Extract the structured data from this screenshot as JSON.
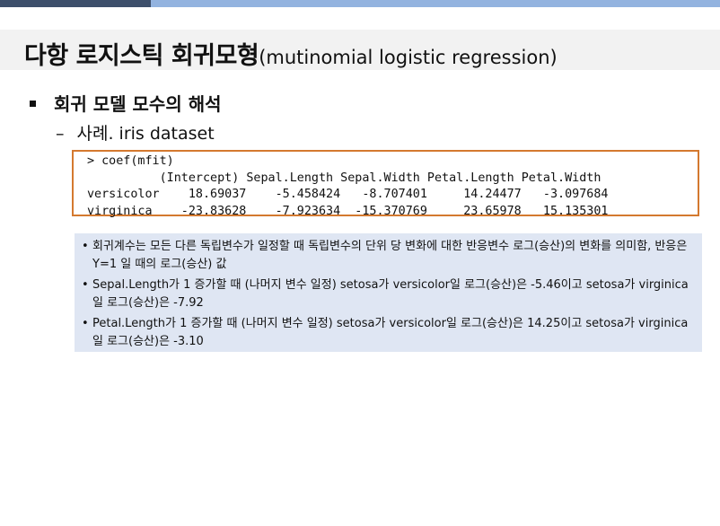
{
  "title": {
    "main": "다항 로지스틱 회귀모형",
    "sub": "(mutinomial logistic regression)"
  },
  "bullet_level1": "회귀 모델 모수의 해석",
  "bullet_level2": {
    "dash": "–",
    "text": "사례. iris dataset"
  },
  "code_output": {
    "command": "> coef(mfit)",
    "header_row": "          (Intercept) Sepal.Length Sepal.Width Petal.Length Petal.Width",
    "row_versicolor": "versicolor    18.69037    -5.458424   -8.707401     14.24477   -3.097684",
    "row_virginica": "virginica    -23.83628    -7.923634  -15.370769     23.65978   15.135301"
  },
  "notes": [
    "회귀계수는 모든 다른 독립변수가 일정할 때 독립변수의 단위 당 변화에 대한 반응변수 로그(승산)의 변화를 의미함,  반응은 Y=1 일 때의 로그(승산) 값",
    "Sepal.Length가  1 증가할 때 (나머지 변수 일정) setosa가 versicolor일 로그(승산)은 -5.46이고 setosa가 virginica일 로그(승산)은 -7.92",
    "Petal.Length가  1 증가할 때 (나머지 변수 일정) setosa가 versicolor일 로그(승산)은  14.25이고 setosa가 virginica일 로그(승산)은 -3.10"
  ],
  "colors": {
    "topbar_dark": "#3d4f6b",
    "topbar_light": "#93b3df",
    "code_border": "#d4792f",
    "note_background": "#dfe6f3"
  }
}
